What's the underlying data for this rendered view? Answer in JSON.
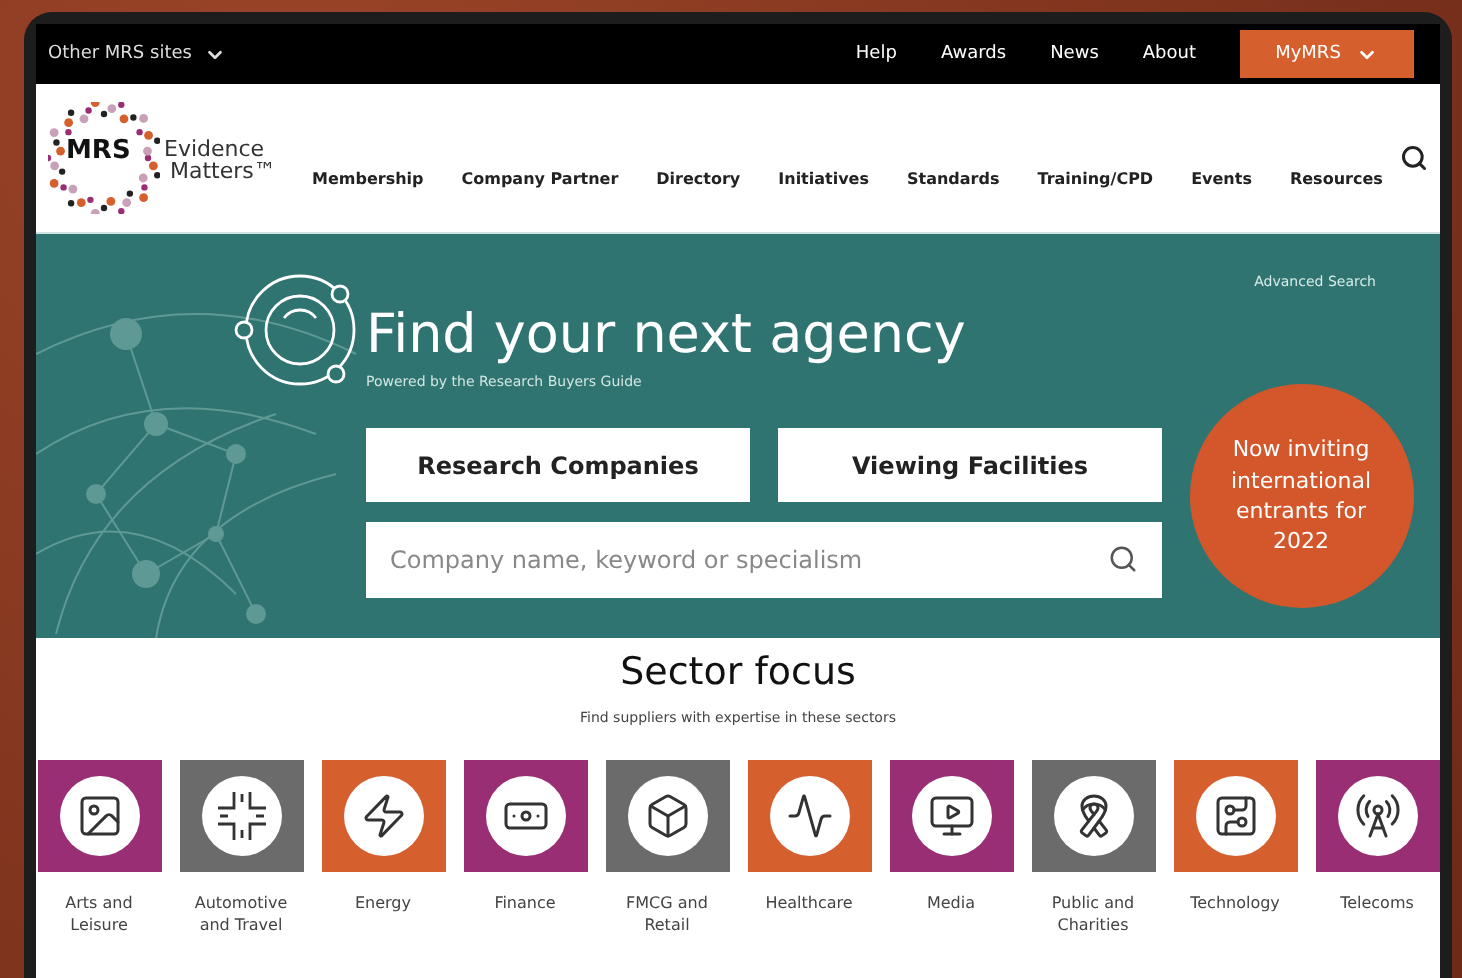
{
  "top_bar": {
    "sites_menu": "Other MRS sites",
    "links": [
      "Help",
      "Awards",
      "News",
      "About"
    ],
    "account_button": "MyMRS"
  },
  "header": {
    "logo": {
      "mark": "MRS",
      "tagline_1": "Evidence",
      "tagline_2": "Matters™"
    },
    "nav": [
      "Membership",
      "Company Partner",
      "Directory",
      "Initiatives",
      "Standards",
      "Training/CPD",
      "Events",
      "Resources"
    ]
  },
  "hero": {
    "advanced_link": "Advanced Search",
    "title": "Find your next agency",
    "subtitle": "Powered by the Research Buyers Guide",
    "buttons": [
      "Research Companies",
      "Viewing Facilities"
    ],
    "search": {
      "placeholder": "Company name, keyword or specialism"
    },
    "badge": "Now inviting international entrants for 2022"
  },
  "sectors": {
    "title": "Sector focus",
    "subtitle": "Find suppliers with expertise in these sectors",
    "items": [
      {
        "label": "Arts and Leisure",
        "kind": "arts",
        "color": "#9a2e74"
      },
      {
        "label": "Automotive and Travel",
        "kind": "automotive",
        "color": "#6b6b6b"
      },
      {
        "label": "Energy",
        "kind": "energy",
        "color": "#d65f2e"
      },
      {
        "label": "Finance",
        "kind": "finance",
        "color": "#9a2e74"
      },
      {
        "label": "FMCG and Retail",
        "kind": "fmcg",
        "color": "#6b6b6b"
      },
      {
        "label": "Healthcare",
        "kind": "healthcare",
        "color": "#d65f2e"
      },
      {
        "label": "Media",
        "kind": "media",
        "color": "#9a2e74"
      },
      {
        "label": "Public and Charities",
        "kind": "public",
        "color": "#6b6b6b"
      },
      {
        "label": "Technology",
        "kind": "technology",
        "color": "#d65f2e"
      },
      {
        "label": "Telecoms",
        "kind": "telecoms",
        "color": "#9a2e74"
      }
    ]
  }
}
